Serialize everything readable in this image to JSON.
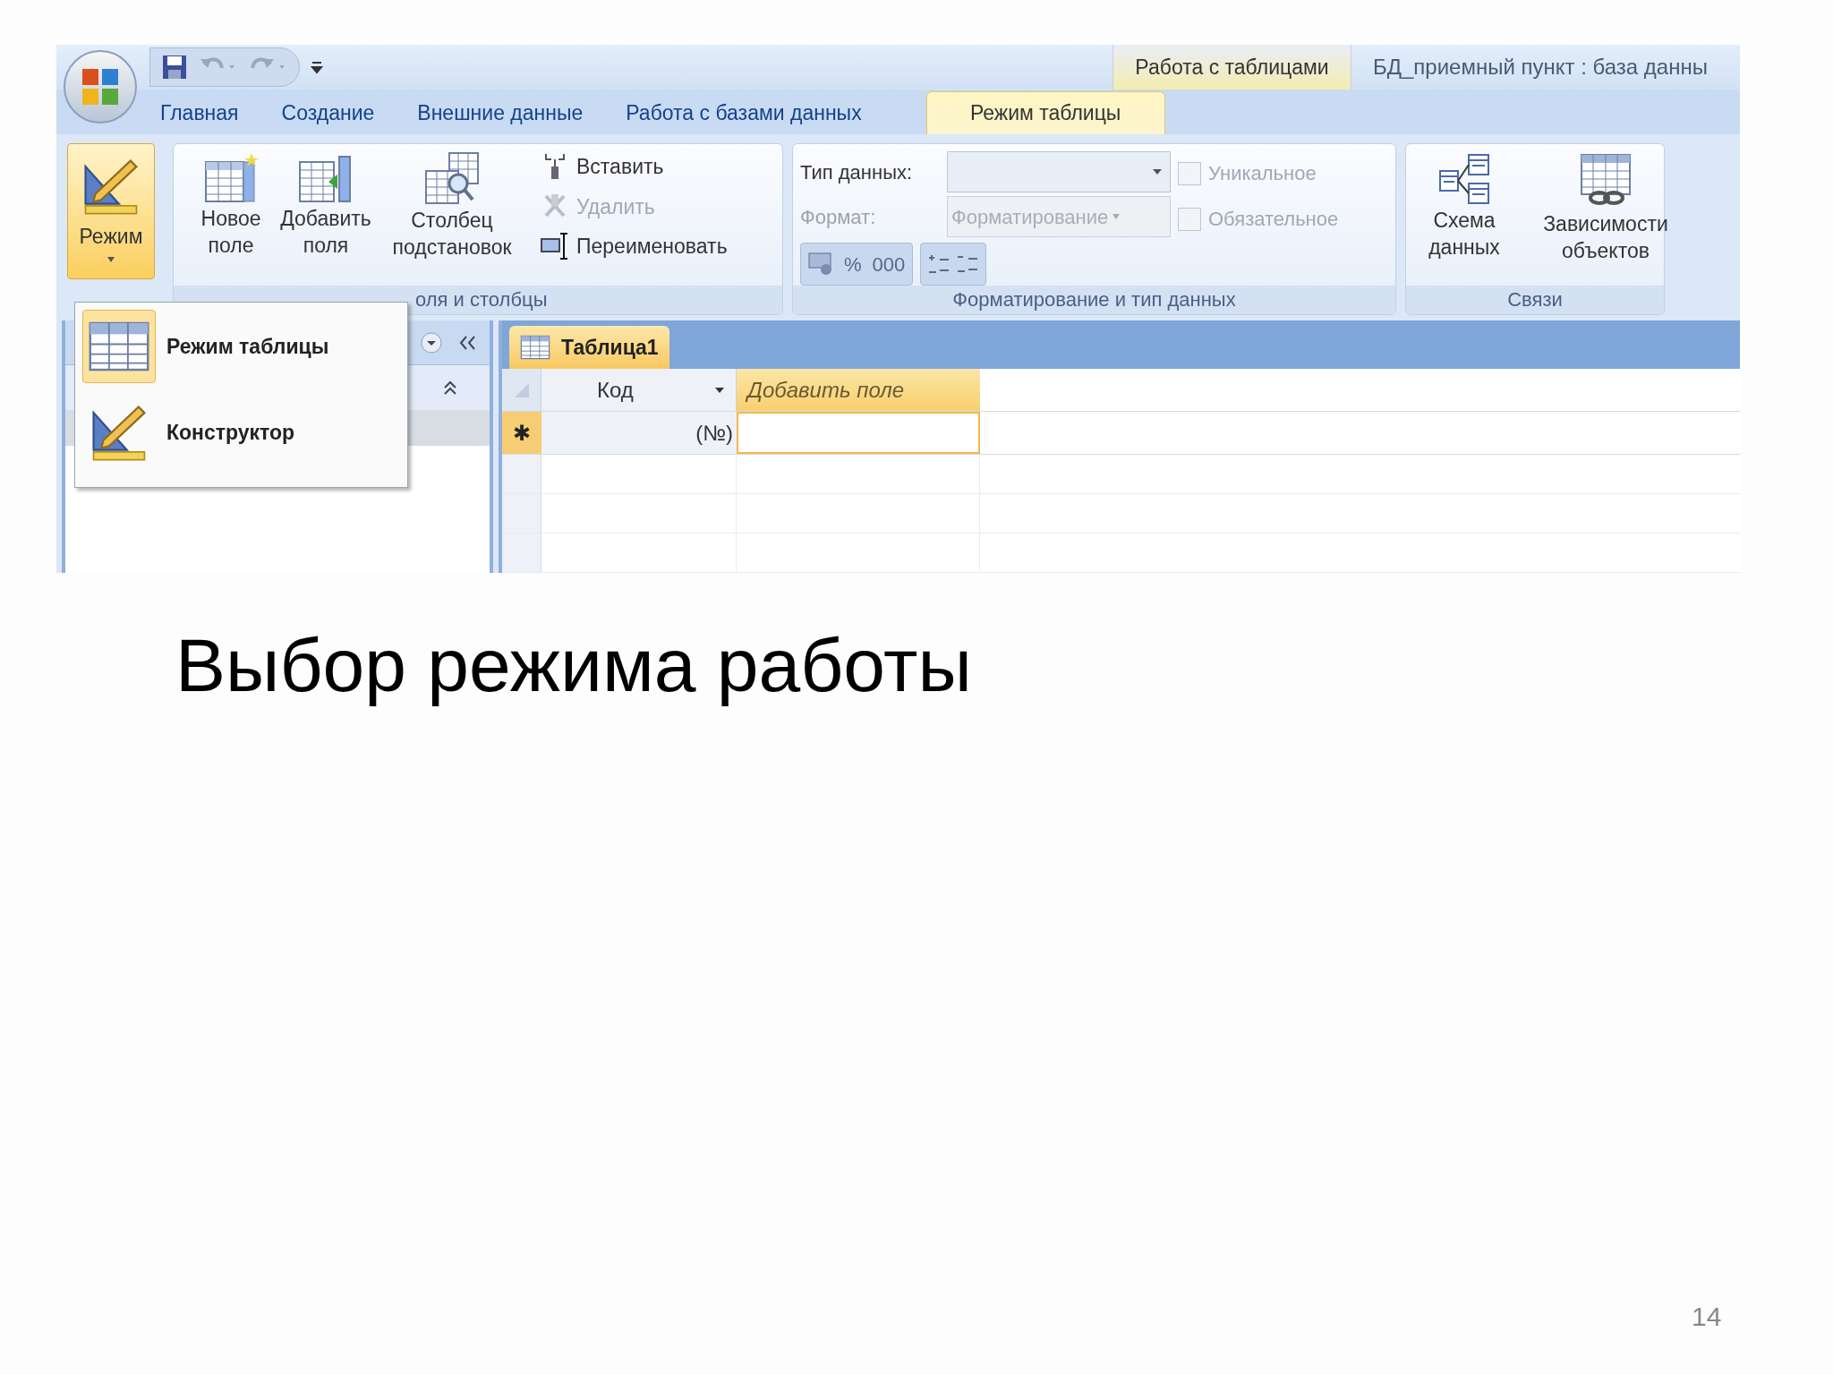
{
  "window": {
    "contextual_tab": "Работа с таблицами",
    "title": "БД_приемный пункт : база данны"
  },
  "tabs": [
    {
      "label": "Главная",
      "selected": false
    },
    {
      "label": "Создание",
      "selected": false
    },
    {
      "label": "Внешние данные",
      "selected": false
    },
    {
      "label": "Работа с базами данных",
      "selected": false
    },
    {
      "label": "Режим таблицы",
      "selected": true
    }
  ],
  "ribbon": {
    "mode_button": {
      "label": "Режим",
      "pressed": true
    },
    "fields_group": {
      "label": "оля и столбцы",
      "buttons": [
        {
          "label": "Новое поле"
        },
        {
          "label": "Добавить поля"
        },
        {
          "label": "Столбец подстановок"
        }
      ],
      "small_buttons": [
        {
          "label": "Вставить",
          "disabled": false
        },
        {
          "label": "Удалить",
          "disabled": true
        },
        {
          "label": "Переименовать",
          "disabled": false
        }
      ]
    },
    "format_group": {
      "label": "Форматирование и тип данных",
      "data_type_label": "Тип данных:",
      "format_label": "Формат:",
      "format_value": "Форматирование",
      "percent": "%",
      "thousands": "000",
      "checkboxes": [
        {
          "label": "Уникальное",
          "checked": false,
          "disabled": true
        },
        {
          "label": "Обязательное",
          "checked": false,
          "disabled": true
        }
      ]
    },
    "relations_group": {
      "label": "Связи",
      "buttons": [
        {
          "label": "Схема данных"
        },
        {
          "label": "Зависимости объектов"
        }
      ]
    }
  },
  "mode_menu": {
    "items": [
      {
        "label": "Режим таблицы",
        "selected": true
      },
      {
        "label": "Конструктор",
        "selected": false
      }
    ]
  },
  "document": {
    "tab": "Таблица1",
    "columns": [
      {
        "label": "Код",
        "kind": "field"
      },
      {
        "label": "Добавить поле",
        "kind": "add"
      }
    ],
    "new_row_marker": "✱",
    "new_row_cells": [
      "(№)",
      ""
    ]
  },
  "slide": {
    "title": "Выбор режима работы",
    "page_number": "14"
  }
}
